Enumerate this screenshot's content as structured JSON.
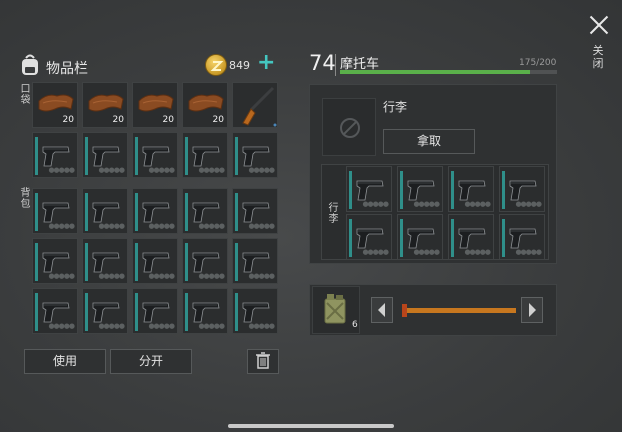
{
  "close": {
    "label": "关闭"
  },
  "inventory": {
    "title": "物品栏",
    "coins": "849",
    "pockets_label": "口袋",
    "backpack_label": "背包",
    "pocket_items": [
      {
        "icon": "leather-icon",
        "qty": "20"
      },
      {
        "icon": "leather-icon",
        "qty": "20"
      },
      {
        "icon": "leather-icon",
        "qty": "20"
      },
      {
        "icon": "leather-icon",
        "qty": "20"
      },
      {
        "icon": "shotgun-icon",
        "qty": ""
      }
    ],
    "use_button": "使用",
    "split_button": "分开",
    "trash_icon": "trash-icon",
    "add_icon": "plus-icon"
  },
  "vehicle": {
    "level": "74",
    "name": "摩托车",
    "capacity": "175/200",
    "capacity_fraction": 0.875,
    "trunk_label": "行李",
    "take_button": "拿取",
    "cargo_label": "行李",
    "fuel_qty": "6",
    "fuel_icon": "jerrycan-icon",
    "bar_color": "#5ab04a"
  },
  "colors": {
    "accent": "#44c6c0",
    "slider": "#c7771f"
  }
}
